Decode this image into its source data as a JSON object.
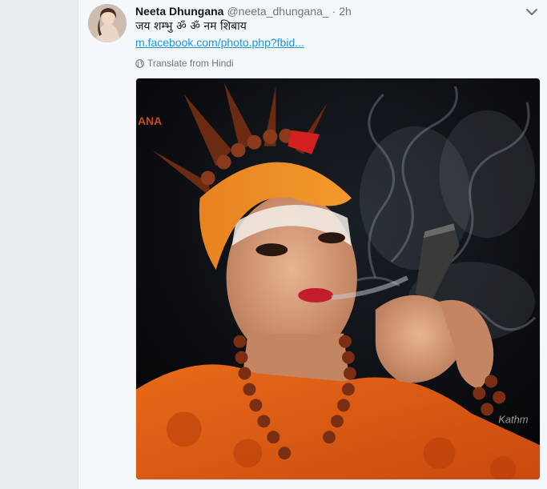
{
  "tweet": {
    "author_name": "Neeta Dhungana",
    "author_handle": "@neeta_dhungana_",
    "separator": "·",
    "time": "2h",
    "text": "जय शम्भु ॐ ॐ नम शिबाय",
    "link_text": "m.facebook.com/photo.php?fbid...",
    "translate_label": "Translate from Hindi",
    "menu_icon": "chevron-down-icon",
    "avatar_icon": "avatar",
    "media": {
      "icon": "photo",
      "watermark_top": "ANA",
      "watermark_bottom": "Kathm"
    }
  },
  "colors": {
    "link": "#1b95e0",
    "secondary_text": "#657786",
    "primary_text": "#14171a",
    "card_bg": "#f5f8fa",
    "page_bg": "#e6ecf0"
  }
}
